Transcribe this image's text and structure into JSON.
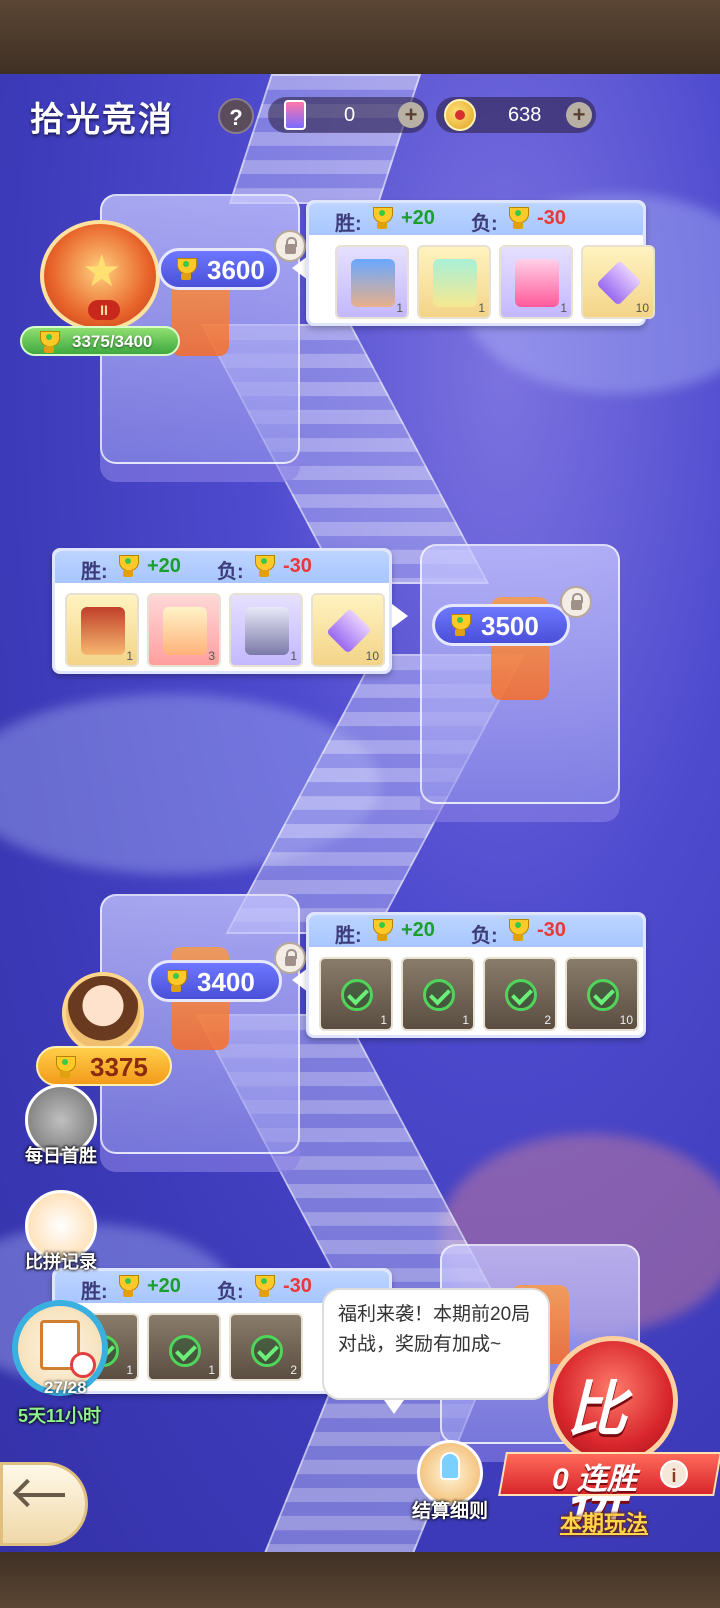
{
  "header": {
    "title": "拾光竞消",
    "help_label": "?",
    "tickets": "0",
    "coins": "638",
    "plus": "+"
  },
  "rank": {
    "progress": "3375/3400",
    "badge_roman": "II"
  },
  "nodes": [
    {
      "score": "3600",
      "locked": true,
      "reward": {
        "win_label": "胜:",
        "win_value": "+20",
        "lose_label": "负:",
        "lose_value": "-30",
        "items": [
          {
            "name": "character-card",
            "count": "1",
            "style": "purple"
          },
          {
            "name": "ticket",
            "count": "1",
            "style": "gold"
          },
          {
            "name": "drink-bottle",
            "count": "1",
            "style": "purple"
          },
          {
            "name": "purple-diamond",
            "count": "10",
            "style": "gold"
          }
        ]
      }
    },
    {
      "score": "3500",
      "locked": true,
      "reward": {
        "win_label": "胜:",
        "win_value": "+20",
        "lose_label": "负:",
        "lose_value": "-30",
        "items": [
          {
            "name": "character-card",
            "count": "1",
            "style": "gold"
          },
          {
            "name": "ticket",
            "count": "3",
            "style": "red"
          },
          {
            "name": "chest-box",
            "count": "1",
            "style": "purple"
          },
          {
            "name": "purple-diamond",
            "count": "10",
            "style": "gold"
          }
        ]
      }
    },
    {
      "score": "3400",
      "locked": true,
      "reward": {
        "win_label": "胜:",
        "win_value": "+20",
        "lose_label": "负:",
        "lose_value": "-30",
        "items": [
          {
            "name": "card-claimed",
            "count": "1",
            "style": "dark"
          },
          {
            "name": "clipboard-claimed",
            "count": "1",
            "style": "dark"
          },
          {
            "name": "card-claimed",
            "count": "2",
            "style": "dark"
          },
          {
            "name": "stone-claimed",
            "count": "10",
            "style": "dark"
          }
        ]
      }
    },
    {
      "reward": {
        "win_label": "胜:",
        "win_value": "+20",
        "lose_label": "负:",
        "lose_value": "-30",
        "items": [
          {
            "name": "card-claimed",
            "count": "1",
            "style": "dark"
          },
          {
            "name": "card-claimed",
            "count": "1",
            "style": "dark"
          },
          {
            "name": "card-claimed",
            "count": "2",
            "style": "dark"
          }
        ]
      }
    }
  ],
  "player": {
    "score": "3375"
  },
  "side": {
    "daily_first_win": "每日首胜",
    "battle_record": "比拼记录",
    "task_count": "27/28",
    "task_time": "5天11小时"
  },
  "bubble": {
    "text": "福利来袭！本期前20局对战，奖励有加成~"
  },
  "bottom": {
    "settle_rules": "结算细则",
    "battle": "比拼",
    "streak": "0 连胜",
    "info": "i",
    "this_season": "本期玩法"
  },
  "colors": {
    "win": "#1aa02a",
    "lose": "#e8383a",
    "accent": "#d8262c"
  }
}
